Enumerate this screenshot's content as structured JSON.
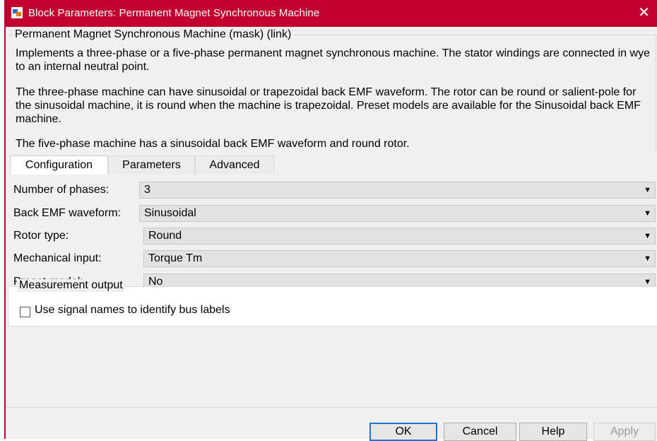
{
  "window": {
    "title": "Block Parameters: Permanent Magnet Synchronous Machine",
    "close_glyph": "✕",
    "app_icon": "simulink-block-icon",
    "accent_color": "#c2002f"
  },
  "header": {
    "title": "Permanent Magnet Synchronous Machine (mask) (link)",
    "paragraphs": [
      "Implements a three-phase or a five-phase permanent magnet synchronous machine. The stator windings are connected in wye to an internal neutral point.",
      "The three-phase machine can have sinusoidal or trapezoidal back EMF waveform. The rotor can be round or salient-pole for the sinusoidal machine, it is round when the machine is trapezoidal. Preset models are available for the Sinusoidal back EMF machine.",
      "The five-phase machine has a sinusoidal back EMF waveform and round rotor."
    ]
  },
  "tabs": [
    {
      "label": "Configuration",
      "active": true
    },
    {
      "label": "Parameters",
      "active": false
    },
    {
      "label": "Advanced",
      "active": false
    }
  ],
  "fields": [
    {
      "label": "Number of phases:",
      "value": "3"
    },
    {
      "label": "Back EMF waveform:",
      "value": "Sinusoidal"
    },
    {
      "label": "Rotor type:",
      "value": "Round"
    },
    {
      "label": "Mechanical input:",
      "value": "Torque Tm"
    },
    {
      "label": "Preset model:",
      "value": "No"
    }
  ],
  "dropdown_arrow": "▼",
  "measurement": {
    "title": "Measurement output",
    "checkbox_label": "Use signal names to identify bus labels",
    "checked": false
  },
  "buttons": {
    "ok": "OK",
    "cancel": "Cancel",
    "help": "Help",
    "apply": "Apply"
  }
}
